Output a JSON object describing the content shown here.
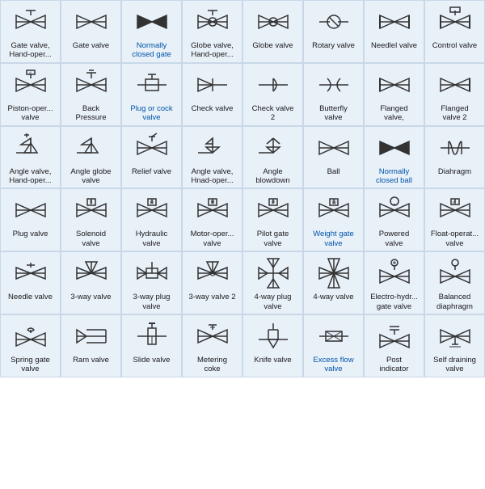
{
  "cells": [
    {
      "id": "gate-valve-hand-oper",
      "label": "Gate valve,\nHand-oper...",
      "labelColor": "black"
    },
    {
      "id": "gate-valve",
      "label": "Gate valve",
      "labelColor": "black"
    },
    {
      "id": "normally-closed-gate",
      "label": "Normally\nclosed gate",
      "labelColor": "blue"
    },
    {
      "id": "globe-valve-hand-oper",
      "label": "Globe valve,\nHand-oper...",
      "labelColor": "black"
    },
    {
      "id": "globe-valve",
      "label": "Globe valve",
      "labelColor": "black"
    },
    {
      "id": "rotary-valve",
      "label": "Rotary valve",
      "labelColor": "black"
    },
    {
      "id": "needle-valve-flanged",
      "label": "Needlel valve",
      "labelColor": "black"
    },
    {
      "id": "control-valve",
      "label": "Control valve",
      "labelColor": "black"
    },
    {
      "id": "piston-oper-valve",
      "label": "Piston-oper...\nvalve",
      "labelColor": "black"
    },
    {
      "id": "back-pressure",
      "label": "Back\nPressure",
      "labelColor": "black"
    },
    {
      "id": "plug-or-cock-valve",
      "label": "Plug or cock\nvalve",
      "labelColor": "blue"
    },
    {
      "id": "check-valve",
      "label": "Check valve",
      "labelColor": "black"
    },
    {
      "id": "check-valve-2",
      "label": "Check valve\n2",
      "labelColor": "black"
    },
    {
      "id": "butterfly-valve",
      "label": "Butterfly\nvalve",
      "labelColor": "black"
    },
    {
      "id": "flanged-valve",
      "label": "Flanged\nvalve,",
      "labelColor": "black"
    },
    {
      "id": "flanged-valve-2",
      "label": "Flanged\nvalve 2",
      "labelColor": "black"
    },
    {
      "id": "angle-valve-hand-oper",
      "label": "Angle valve,\nHand-oper...",
      "labelColor": "black"
    },
    {
      "id": "angle-globe-valve",
      "label": "Angle globe\nvalve",
      "labelColor": "black"
    },
    {
      "id": "relief-valve",
      "label": "Relief valve",
      "labelColor": "black"
    },
    {
      "id": "angle-valve-hnad",
      "label": "Angle valve,\nHnad-oper...",
      "labelColor": "black"
    },
    {
      "id": "angle-blowdown",
      "label": "Angle\nblowdown",
      "labelColor": "black"
    },
    {
      "id": "ball",
      "label": "Ball",
      "labelColor": "black"
    },
    {
      "id": "normally-closed-ball",
      "label": "Normally\nclosed ball",
      "labelColor": "blue"
    },
    {
      "id": "diaphragm",
      "label": "Diahragm",
      "labelColor": "black"
    },
    {
      "id": "plug-valve",
      "label": "Plug valve",
      "labelColor": "black"
    },
    {
      "id": "solenoid-valve",
      "label": "Solenoid\nvalve",
      "labelColor": "black"
    },
    {
      "id": "hydraulic-valve",
      "label": "Hydraulic\nvalve",
      "labelColor": "black"
    },
    {
      "id": "motor-oper-valve",
      "label": "Motor-oper...\nvalve",
      "labelColor": "black"
    },
    {
      "id": "pilot-gate-valve",
      "label": "Pilot gate\nvalve",
      "labelColor": "black"
    },
    {
      "id": "weight-gate-valve",
      "label": "Weight gate\nvalve",
      "labelColor": "blue"
    },
    {
      "id": "powered-valve",
      "label": "Powered\nvalve",
      "labelColor": "black"
    },
    {
      "id": "float-operat-valve",
      "label": "Float-operat...\nvalve",
      "labelColor": "black"
    },
    {
      "id": "needle-valve",
      "label": "Needle valve",
      "labelColor": "black"
    },
    {
      "id": "3way-valve",
      "label": "3-way valve",
      "labelColor": "black"
    },
    {
      "id": "3way-plug-valve",
      "label": "3-way plug\nvalve",
      "labelColor": "black"
    },
    {
      "id": "3way-valve-2",
      "label": "3-way valve 2",
      "labelColor": "black"
    },
    {
      "id": "4way-plug-valve",
      "label": "4-way plug\nvalve",
      "labelColor": "black"
    },
    {
      "id": "4way-valve",
      "label": "4-way valve",
      "labelColor": "black"
    },
    {
      "id": "electro-hydr-gate",
      "label": "Electro-hydr...\ngate valve",
      "labelColor": "black"
    },
    {
      "id": "balanced-diaphragm",
      "label": "Balanced\ndiaphragm",
      "labelColor": "black"
    },
    {
      "id": "spring-gate-valve",
      "label": "Spring gate\nvalve",
      "labelColor": "black"
    },
    {
      "id": "ram-valve",
      "label": "Ram valve",
      "labelColor": "black"
    },
    {
      "id": "slide-valve",
      "label": "Slide valve",
      "labelColor": "black"
    },
    {
      "id": "metering-coke",
      "label": "Metering\ncoke",
      "labelColor": "black"
    },
    {
      "id": "knife-valve",
      "label": "Knife valve",
      "labelColor": "black"
    },
    {
      "id": "excess-flow-valve",
      "label": "Excess flow\nvalve",
      "labelColor": "blue"
    },
    {
      "id": "post-indicator",
      "label": "Post\nindicator",
      "labelColor": "black"
    },
    {
      "id": "self-draining-valve",
      "label": "Self draining\nvalve",
      "labelColor": "black"
    }
  ]
}
